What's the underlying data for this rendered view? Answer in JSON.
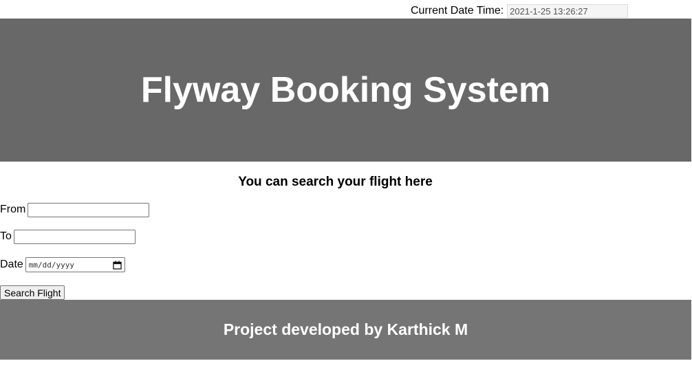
{
  "datetime": {
    "label": "Current Date Time:",
    "value": "2021-1-25 13:26:27"
  },
  "header": {
    "title": "Flyway Booking System"
  },
  "search": {
    "heading": "You can search your flight here",
    "from_label": "From",
    "from_value": "",
    "to_label": "To",
    "to_value": "",
    "date_label": "Date",
    "date_placeholder": "mm/dd/yyyy",
    "submit_label": "Search Flight"
  },
  "footer": {
    "text": "Project developed by Karthick M"
  },
  "colors": {
    "header_bg": "#686868",
    "footer_bg": "#757575"
  },
  "icons": {
    "date_picker": "calendar-icon"
  }
}
